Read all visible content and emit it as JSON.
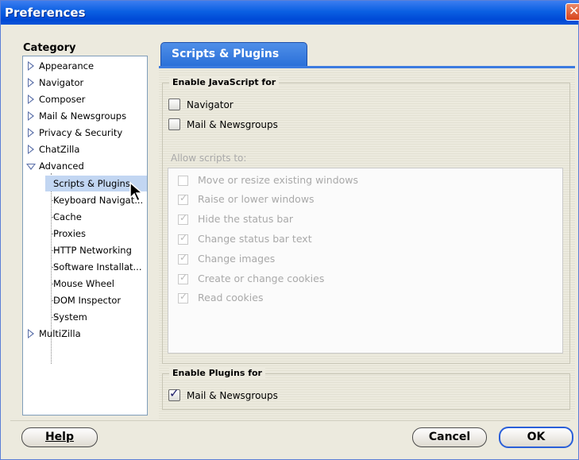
{
  "window": {
    "title": "Preferences"
  },
  "sidebar": {
    "label": "Category",
    "items": [
      {
        "label": "Appearance"
      },
      {
        "label": "Navigator"
      },
      {
        "label": "Composer"
      },
      {
        "label": "Mail & Newsgroups"
      },
      {
        "label": "Privacy & Security"
      },
      {
        "label": "ChatZilla"
      },
      {
        "label": "Advanced"
      },
      {
        "label": "Scripts & Plugins"
      },
      {
        "label": "Keyboard Navigat..."
      },
      {
        "label": "Cache"
      },
      {
        "label": "Proxies"
      },
      {
        "label": "HTTP Networking"
      },
      {
        "label": "Software Installat..."
      },
      {
        "label": "Mouse Wheel"
      },
      {
        "label": "DOM Inspector"
      },
      {
        "label": "System"
      },
      {
        "label": "MultiZilla"
      }
    ]
  },
  "main": {
    "tab": "Scripts & Plugins",
    "javascript_group": {
      "legend": "Enable JavaScript for",
      "options": [
        {
          "label": "Navigator",
          "checked": false
        },
        {
          "label": "Mail & Newsgroups",
          "checked": false
        }
      ]
    },
    "allow_label": "Allow scripts to:",
    "allow_items": [
      {
        "label": "Move or resize existing windows",
        "checked": false
      },
      {
        "label": "Raise or lower windows",
        "checked": true
      },
      {
        "label": "Hide the status bar",
        "checked": true
      },
      {
        "label": "Change status bar text",
        "checked": true
      },
      {
        "label": "Change images",
        "checked": true
      },
      {
        "label": "Create or change cookies",
        "checked": true
      },
      {
        "label": "Read cookies",
        "checked": true
      }
    ],
    "plugins_group": {
      "legend": "Enable Plugins for",
      "options": [
        {
          "label": "Mail & Newsgroups",
          "checked": true
        }
      ]
    }
  },
  "buttons": {
    "help_label": "Help",
    "cancel_label": "Cancel",
    "ok_label": "OK"
  },
  "colors": {
    "titlebar": "#0a5fe2",
    "tab_accent": "#3c7be0",
    "window_bg": "#eceade"
  }
}
